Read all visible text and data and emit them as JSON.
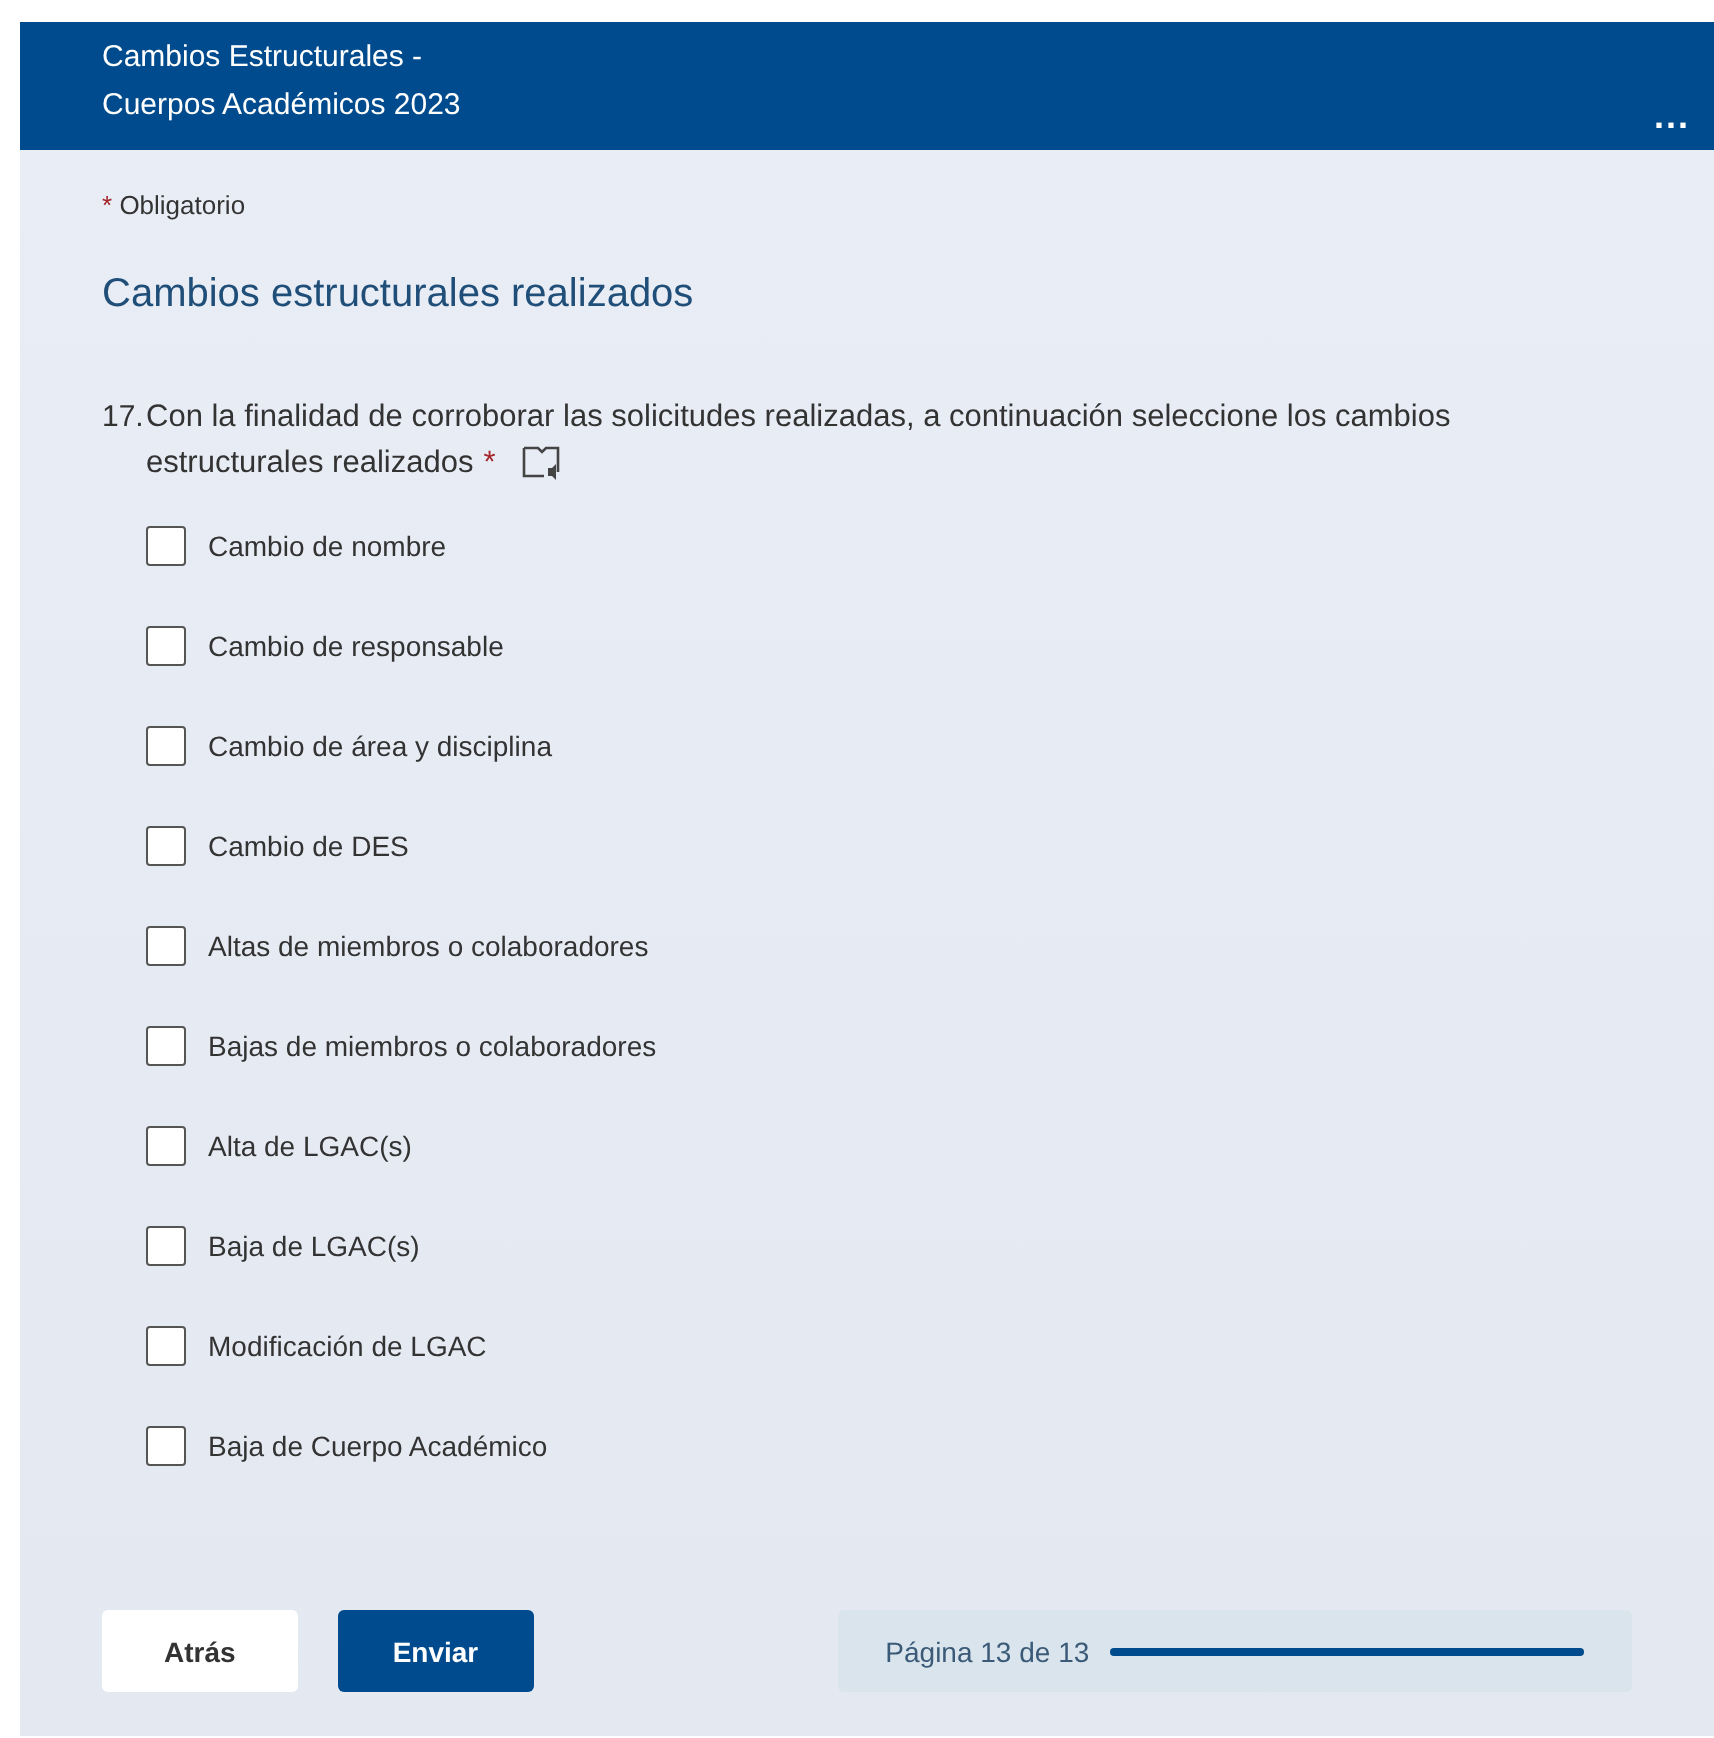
{
  "header": {
    "title_lines": [
      "Cambios Estructurales -",
      "Cuerpos Académicos 2023"
    ],
    "menu": "..."
  },
  "required_note": {
    "mark": "*",
    "text": "Obligatorio"
  },
  "section_title": "Cambios estructurales realizados",
  "question": {
    "number": "17.",
    "text_lines": [
      "Con la finalidad de corroborar las solicitudes realizadas, a continuación seleccione los cambios",
      "estructurales realizados"
    ],
    "required_mark": "*",
    "options": [
      {
        "label": "Cambio de nombre",
        "checked": false
      },
      {
        "label": "Cambio de responsable",
        "checked": false
      },
      {
        "label": "Cambio de área y disciplina",
        "checked": false
      },
      {
        "label": "Cambio de DES",
        "checked": false
      },
      {
        "label": "Altas de miembros o colaboradores",
        "checked": false
      },
      {
        "label": "Bajas de miembros o colaboradores",
        "checked": false
      },
      {
        "label": "Alta de LGAC(s)",
        "checked": false
      },
      {
        "label": "Baja de LGAC(s)",
        "checked": false
      },
      {
        "label": "Modificación de LGAC",
        "checked": false
      },
      {
        "label": "Baja de Cuerpo Académico",
        "checked": false
      }
    ]
  },
  "buttons": [
    {
      "label": "Atrás",
      "kind": "secondary"
    },
    {
      "label": "Enviar",
      "kind": "primary"
    }
  ],
  "progress": {
    "text": "Página 13 de 13",
    "level": 1
  }
}
